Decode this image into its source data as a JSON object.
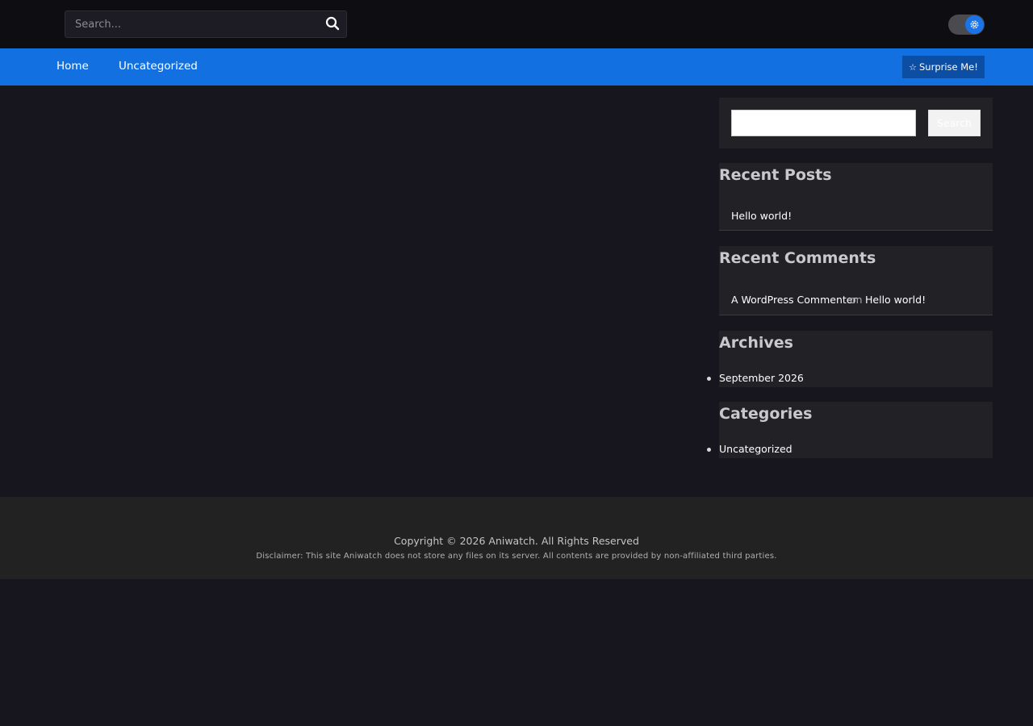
{
  "header": {
    "search_placeholder": "Search...",
    "search_icon": "search-icon",
    "toggle_icon": "gear-icon"
  },
  "nav": {
    "items": [
      {
        "label": "Home"
      },
      {
        "label": "Uncategorized"
      }
    ],
    "surprise_label": "Surprise Me!",
    "surprise_icon": "star-outline-icon"
  },
  "sidebar": {
    "search": {
      "value": "",
      "button_label": "Search"
    },
    "recent_posts": {
      "title": "Recent Posts",
      "items": [
        {
          "label": "Hello world!"
        }
      ]
    },
    "recent_comments": {
      "title": "Recent Comments",
      "items": [
        {
          "author": "A WordPress Commenter",
          "on": "on",
          "post": "Hello world!"
        }
      ]
    },
    "archives": {
      "title": "Archives",
      "items": [
        {
          "label": "September 2026"
        }
      ]
    },
    "categories": {
      "title": "Categories",
      "items": [
        {
          "label": "Uncategorized"
        }
      ]
    }
  },
  "footer": {
    "copyright": "Copyright © 2026 Aniwatch. All Rights Reserved",
    "disclaimer": "Disclaimer: This site Aniwatch does not store any files on its server. All contents are provided by non-affiliated third parties."
  },
  "colors": {
    "accent": "#1270e0",
    "background": "#17161f",
    "topbar": "#0e0d12",
    "widget": "#222226",
    "footer": "#222222"
  }
}
